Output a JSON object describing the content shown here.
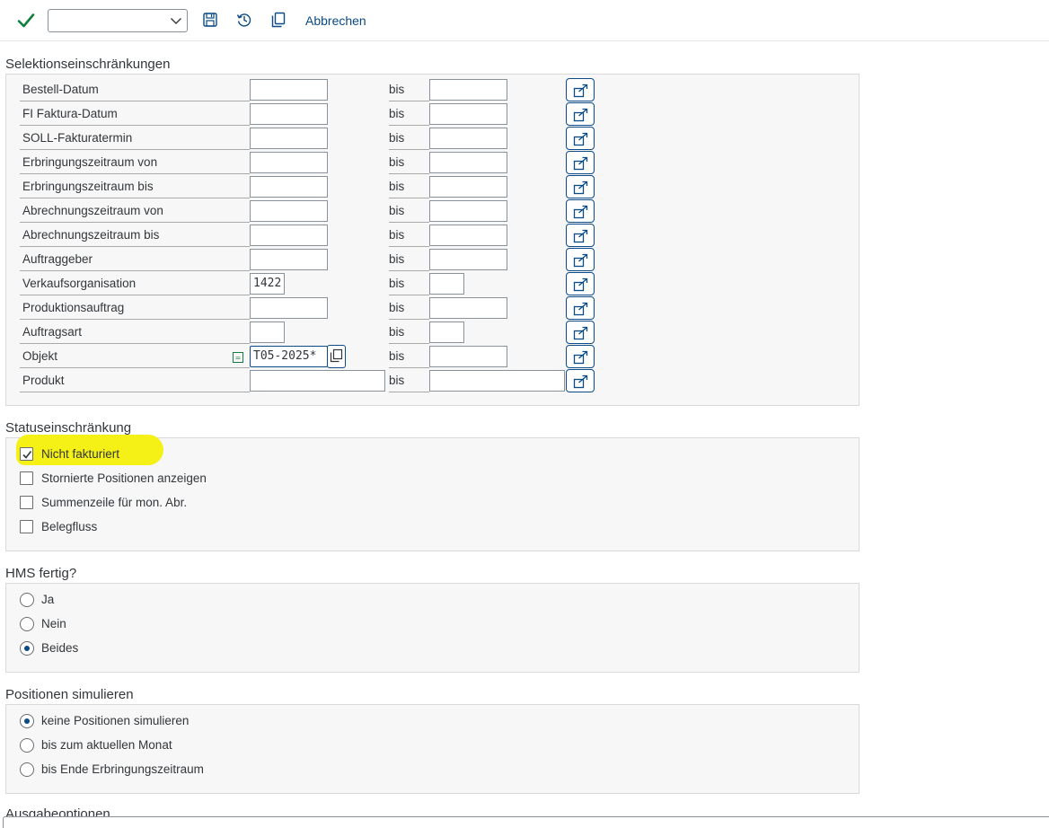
{
  "toolbar": {
    "check_icon": "checkmark-icon",
    "dropdown_value": "",
    "save_icon": "save-icon",
    "history_icon": "history-icon",
    "copy_icon": "copy-icon",
    "cancel_label": "Abbrechen",
    "accent_color": "#0a4a86",
    "check_color": "#107e3e"
  },
  "selection": {
    "title": "Selektionseinschränkungen",
    "bis_label": "bis",
    "rows": [
      {
        "label": "Bestell-Datum",
        "from": "",
        "to": ""
      },
      {
        "label": "FI Faktura-Datum",
        "from": "",
        "to": ""
      },
      {
        "label": "SOLL-Fakturatermin",
        "from": "",
        "to": ""
      },
      {
        "label": "Erbringungszeitraum von",
        "from": "",
        "to": ""
      },
      {
        "label": "Erbringungszeitraum bis",
        "from": "",
        "to": ""
      },
      {
        "label": "Abrechnungszeitraum von",
        "from": "",
        "to": ""
      },
      {
        "label": "Abrechnungszeitraum bis",
        "from": "",
        "to": ""
      },
      {
        "label": "Auftraggeber",
        "from": "",
        "to": ""
      },
      {
        "label": "Verkaufsorganisation",
        "from": "1422",
        "to": ""
      },
      {
        "label": "Produktionsauftrag",
        "from": "",
        "to": ""
      },
      {
        "label": "Auftragsart",
        "from": "",
        "to": ""
      },
      {
        "label": "Objekt",
        "from": "T05-2025*",
        "to": ""
      },
      {
        "label": "Produkt",
        "from": "",
        "to": ""
      }
    ]
  },
  "status": {
    "title": "Statuseinschränkung",
    "options": [
      {
        "label": "Nicht fakturiert",
        "checked": true
      },
      {
        "label": "Stornierte Positionen anzeigen",
        "checked": false
      },
      {
        "label": "Summenzeile für mon. Abr.",
        "checked": false
      },
      {
        "label": "Belegfluss",
        "checked": false
      }
    ],
    "highlight_color": "#f5f015"
  },
  "hms": {
    "title": "HMS fertig?",
    "options": [
      {
        "label": "Ja",
        "selected": false
      },
      {
        "label": "Nein",
        "selected": false
      },
      {
        "label": "Beides",
        "selected": true
      }
    ]
  },
  "simulate": {
    "title": "Positionen simulieren",
    "options": [
      {
        "label": "keine Positionen simulieren",
        "selected": true
      },
      {
        "label": "bis zum aktuellen Monat",
        "selected": false
      },
      {
        "label": "bis Ende Erbringungszeitraum",
        "selected": false
      }
    ]
  },
  "next_section": {
    "title": "Ausgabeoptionen"
  }
}
